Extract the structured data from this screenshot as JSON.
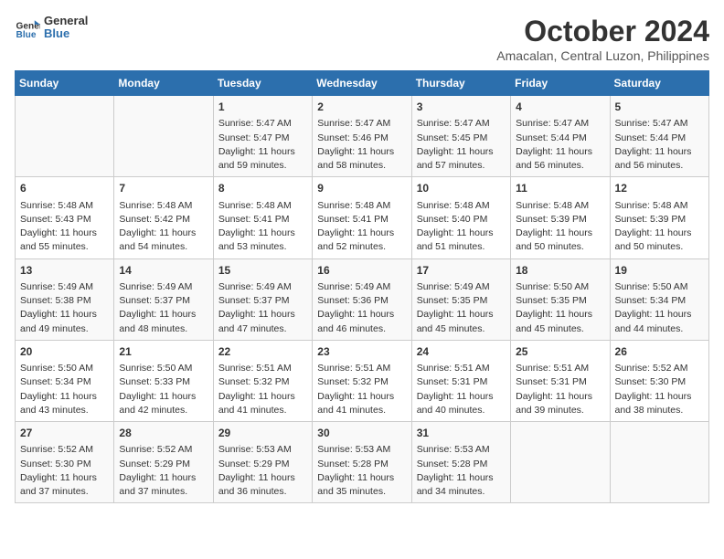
{
  "header": {
    "logo_line1": "General",
    "logo_line2": "Blue",
    "month": "October 2024",
    "location": "Amacalan, Central Luzon, Philippines"
  },
  "weekdays": [
    "Sunday",
    "Monday",
    "Tuesday",
    "Wednesday",
    "Thursday",
    "Friday",
    "Saturday"
  ],
  "weeks": [
    [
      {
        "day": "",
        "sunrise": "",
        "sunset": "",
        "daylight": ""
      },
      {
        "day": "",
        "sunrise": "",
        "sunset": "",
        "daylight": ""
      },
      {
        "day": "1",
        "sunrise": "Sunrise: 5:47 AM",
        "sunset": "Sunset: 5:47 PM",
        "daylight": "Daylight: 11 hours and 59 minutes."
      },
      {
        "day": "2",
        "sunrise": "Sunrise: 5:47 AM",
        "sunset": "Sunset: 5:46 PM",
        "daylight": "Daylight: 11 hours and 58 minutes."
      },
      {
        "day": "3",
        "sunrise": "Sunrise: 5:47 AM",
        "sunset": "Sunset: 5:45 PM",
        "daylight": "Daylight: 11 hours and 57 minutes."
      },
      {
        "day": "4",
        "sunrise": "Sunrise: 5:47 AM",
        "sunset": "Sunset: 5:44 PM",
        "daylight": "Daylight: 11 hours and 56 minutes."
      },
      {
        "day": "5",
        "sunrise": "Sunrise: 5:47 AM",
        "sunset": "Sunset: 5:44 PM",
        "daylight": "Daylight: 11 hours and 56 minutes."
      }
    ],
    [
      {
        "day": "6",
        "sunrise": "Sunrise: 5:48 AM",
        "sunset": "Sunset: 5:43 PM",
        "daylight": "Daylight: 11 hours and 55 minutes."
      },
      {
        "day": "7",
        "sunrise": "Sunrise: 5:48 AM",
        "sunset": "Sunset: 5:42 PM",
        "daylight": "Daylight: 11 hours and 54 minutes."
      },
      {
        "day": "8",
        "sunrise": "Sunrise: 5:48 AM",
        "sunset": "Sunset: 5:41 PM",
        "daylight": "Daylight: 11 hours and 53 minutes."
      },
      {
        "day": "9",
        "sunrise": "Sunrise: 5:48 AM",
        "sunset": "Sunset: 5:41 PM",
        "daylight": "Daylight: 11 hours and 52 minutes."
      },
      {
        "day": "10",
        "sunrise": "Sunrise: 5:48 AM",
        "sunset": "Sunset: 5:40 PM",
        "daylight": "Daylight: 11 hours and 51 minutes."
      },
      {
        "day": "11",
        "sunrise": "Sunrise: 5:48 AM",
        "sunset": "Sunset: 5:39 PM",
        "daylight": "Daylight: 11 hours and 50 minutes."
      },
      {
        "day": "12",
        "sunrise": "Sunrise: 5:48 AM",
        "sunset": "Sunset: 5:39 PM",
        "daylight": "Daylight: 11 hours and 50 minutes."
      }
    ],
    [
      {
        "day": "13",
        "sunrise": "Sunrise: 5:49 AM",
        "sunset": "Sunset: 5:38 PM",
        "daylight": "Daylight: 11 hours and 49 minutes."
      },
      {
        "day": "14",
        "sunrise": "Sunrise: 5:49 AM",
        "sunset": "Sunset: 5:37 PM",
        "daylight": "Daylight: 11 hours and 48 minutes."
      },
      {
        "day": "15",
        "sunrise": "Sunrise: 5:49 AM",
        "sunset": "Sunset: 5:37 PM",
        "daylight": "Daylight: 11 hours and 47 minutes."
      },
      {
        "day": "16",
        "sunrise": "Sunrise: 5:49 AM",
        "sunset": "Sunset: 5:36 PM",
        "daylight": "Daylight: 11 hours and 46 minutes."
      },
      {
        "day": "17",
        "sunrise": "Sunrise: 5:49 AM",
        "sunset": "Sunset: 5:35 PM",
        "daylight": "Daylight: 11 hours and 45 minutes."
      },
      {
        "day": "18",
        "sunrise": "Sunrise: 5:50 AM",
        "sunset": "Sunset: 5:35 PM",
        "daylight": "Daylight: 11 hours and 45 minutes."
      },
      {
        "day": "19",
        "sunrise": "Sunrise: 5:50 AM",
        "sunset": "Sunset: 5:34 PM",
        "daylight": "Daylight: 11 hours and 44 minutes."
      }
    ],
    [
      {
        "day": "20",
        "sunrise": "Sunrise: 5:50 AM",
        "sunset": "Sunset: 5:34 PM",
        "daylight": "Daylight: 11 hours and 43 minutes."
      },
      {
        "day": "21",
        "sunrise": "Sunrise: 5:50 AM",
        "sunset": "Sunset: 5:33 PM",
        "daylight": "Daylight: 11 hours and 42 minutes."
      },
      {
        "day": "22",
        "sunrise": "Sunrise: 5:51 AM",
        "sunset": "Sunset: 5:32 PM",
        "daylight": "Daylight: 11 hours and 41 minutes."
      },
      {
        "day": "23",
        "sunrise": "Sunrise: 5:51 AM",
        "sunset": "Sunset: 5:32 PM",
        "daylight": "Daylight: 11 hours and 41 minutes."
      },
      {
        "day": "24",
        "sunrise": "Sunrise: 5:51 AM",
        "sunset": "Sunset: 5:31 PM",
        "daylight": "Daylight: 11 hours and 40 minutes."
      },
      {
        "day": "25",
        "sunrise": "Sunrise: 5:51 AM",
        "sunset": "Sunset: 5:31 PM",
        "daylight": "Daylight: 11 hours and 39 minutes."
      },
      {
        "day": "26",
        "sunrise": "Sunrise: 5:52 AM",
        "sunset": "Sunset: 5:30 PM",
        "daylight": "Daylight: 11 hours and 38 minutes."
      }
    ],
    [
      {
        "day": "27",
        "sunrise": "Sunrise: 5:52 AM",
        "sunset": "Sunset: 5:30 PM",
        "daylight": "Daylight: 11 hours and 37 minutes."
      },
      {
        "day": "28",
        "sunrise": "Sunrise: 5:52 AM",
        "sunset": "Sunset: 5:29 PM",
        "daylight": "Daylight: 11 hours and 37 minutes."
      },
      {
        "day": "29",
        "sunrise": "Sunrise: 5:53 AM",
        "sunset": "Sunset: 5:29 PM",
        "daylight": "Daylight: 11 hours and 36 minutes."
      },
      {
        "day": "30",
        "sunrise": "Sunrise: 5:53 AM",
        "sunset": "Sunset: 5:28 PM",
        "daylight": "Daylight: 11 hours and 35 minutes."
      },
      {
        "day": "31",
        "sunrise": "Sunrise: 5:53 AM",
        "sunset": "Sunset: 5:28 PM",
        "daylight": "Daylight: 11 hours and 34 minutes."
      },
      {
        "day": "",
        "sunrise": "",
        "sunset": "",
        "daylight": ""
      },
      {
        "day": "",
        "sunrise": "",
        "sunset": "",
        "daylight": ""
      }
    ]
  ]
}
